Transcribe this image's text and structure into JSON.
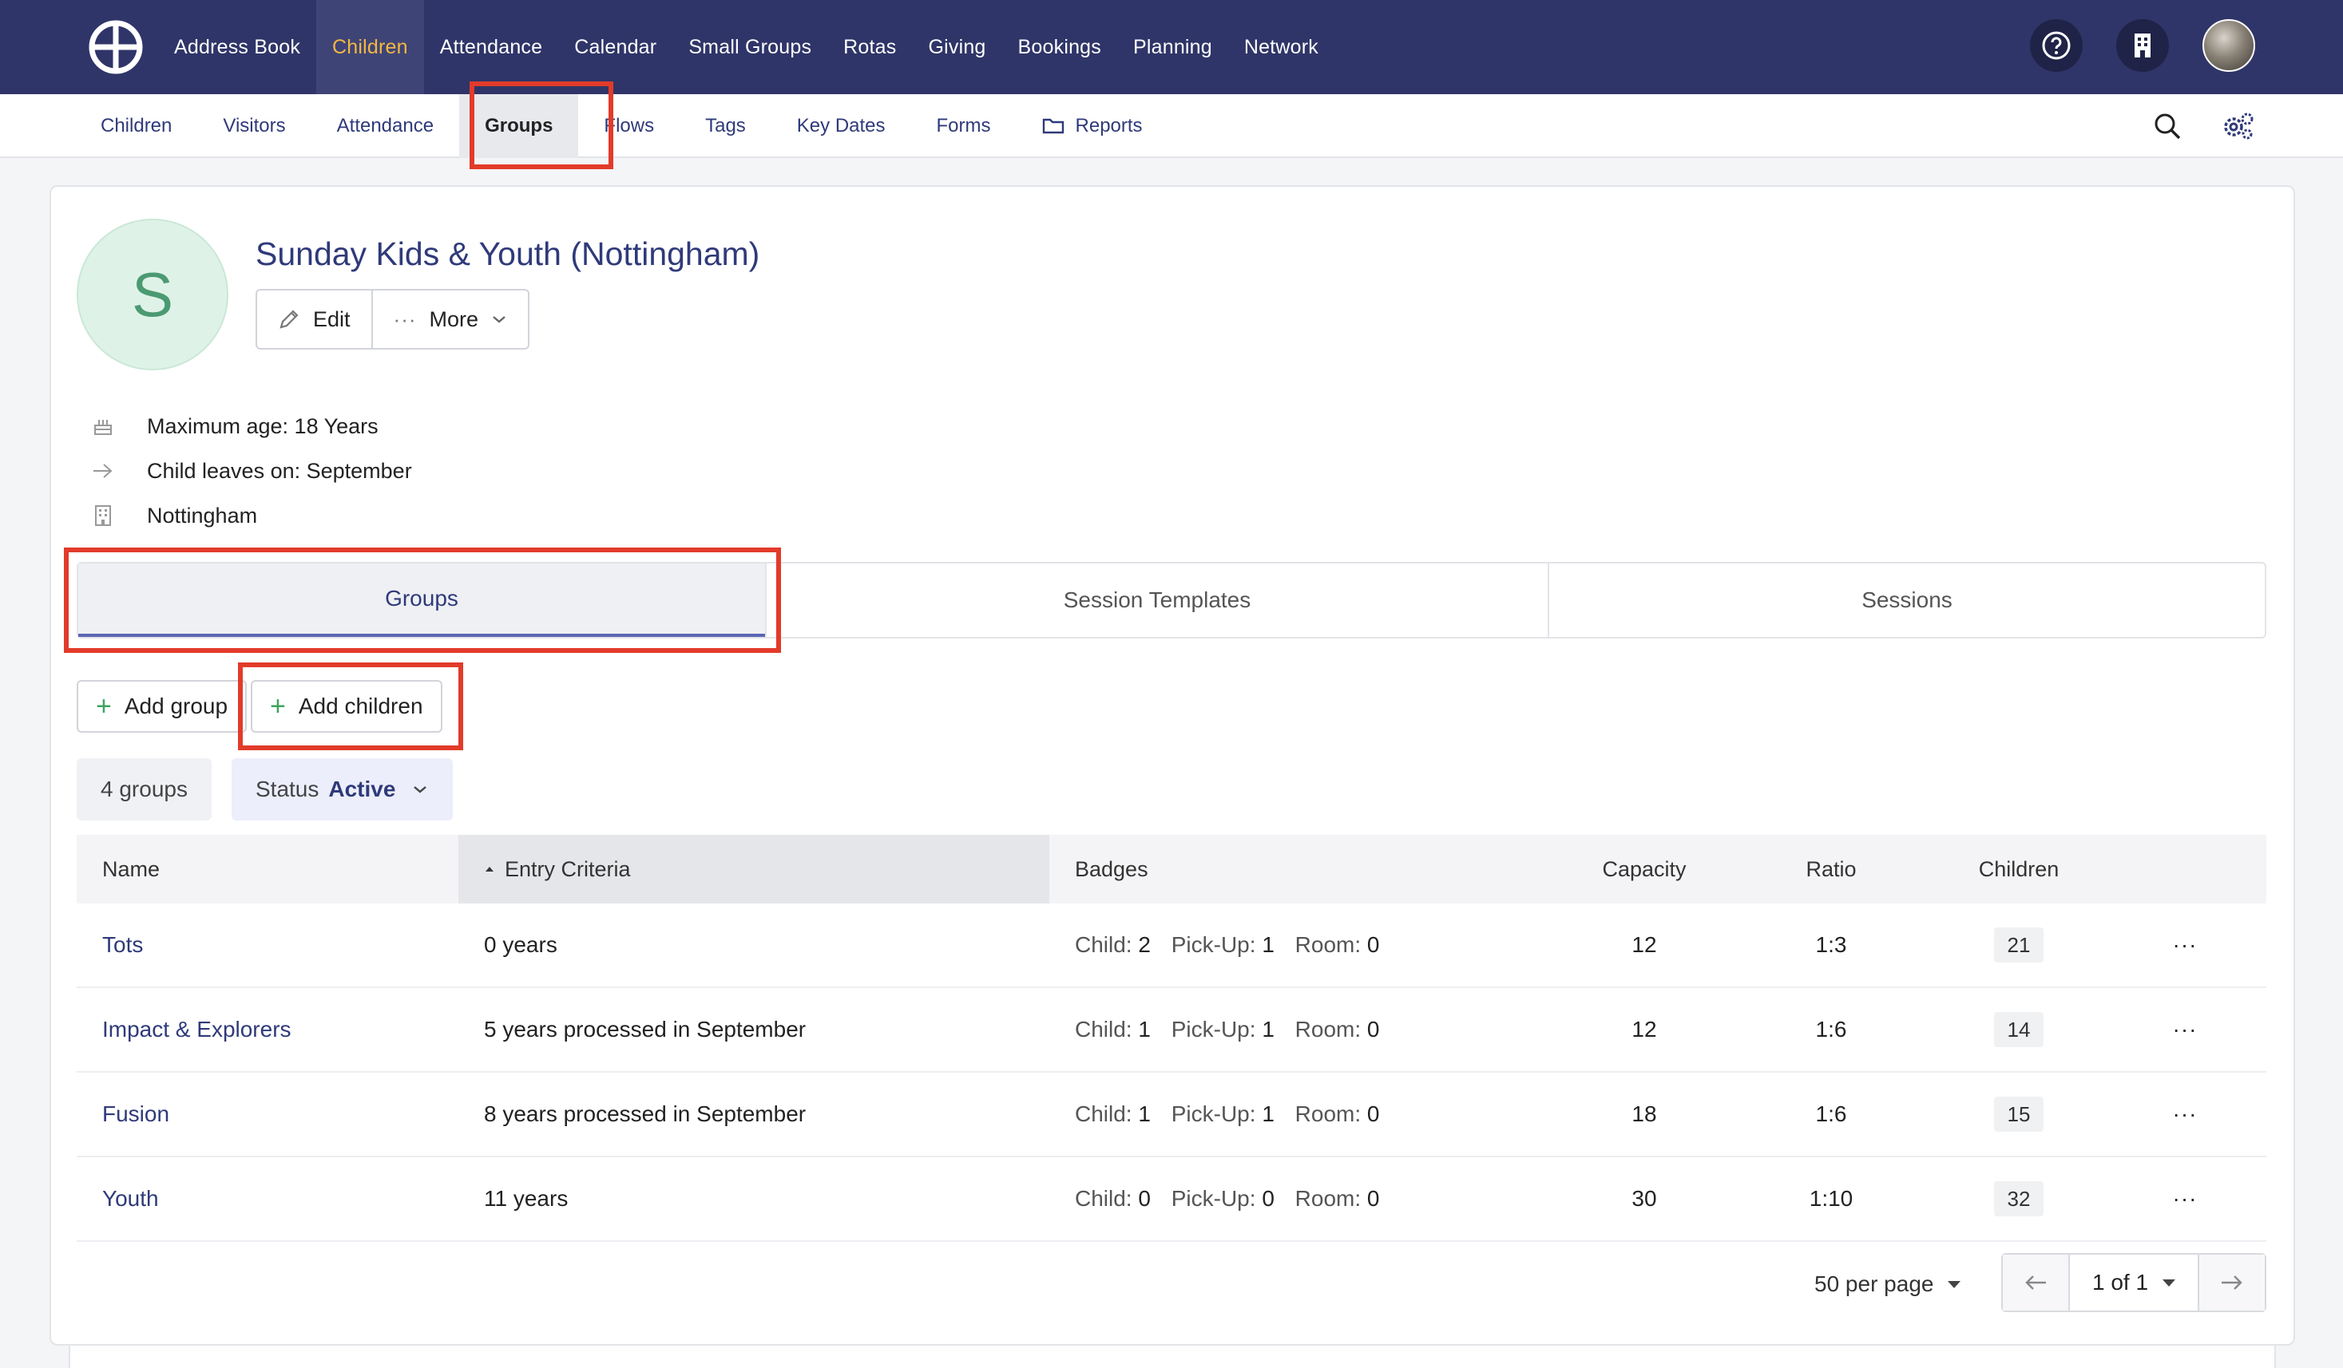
{
  "top_nav": {
    "items": [
      "Address Book",
      "Children",
      "Attendance",
      "Calendar",
      "Small Groups",
      "Rotas",
      "Giving",
      "Bookings",
      "Planning",
      "Network"
    ],
    "active": "Children"
  },
  "sub_nav": {
    "items": [
      "Children",
      "Visitors",
      "Attendance",
      "Groups",
      "Flows",
      "Tags",
      "Key Dates",
      "Forms",
      "Reports"
    ],
    "active": "Groups"
  },
  "group": {
    "initial": "S",
    "title": "Sunday Kids & Youth (Nottingham)",
    "edit_label": "Edit",
    "more_label": "More",
    "info": {
      "max_age": "Maximum age: 18 Years",
      "leaves_on": "Child leaves on: September",
      "location": "Nottingham"
    }
  },
  "tabs": [
    "Groups",
    "Session Templates",
    "Sessions"
  ],
  "actions": {
    "add_group": "Add group",
    "add_children": "Add children"
  },
  "filters": {
    "count": "4 groups",
    "status_label": "Status",
    "status_value": "Active"
  },
  "table": {
    "headers": {
      "name": "Name",
      "entry": "Entry Criteria",
      "badges": "Badges",
      "capacity": "Capacity",
      "ratio": "Ratio",
      "children": "Children"
    },
    "badge_labels": {
      "child": "Child:",
      "pickup": "Pick-Up:",
      "room": "Room:"
    },
    "rows": [
      {
        "name": "Tots",
        "entry": "0 years",
        "child": "2",
        "pickup": "1",
        "room": "0",
        "capacity": "12",
        "ratio": "1:3",
        "children": "21"
      },
      {
        "name": "Impact & Explorers",
        "entry": "5 years processed in September",
        "child": "1",
        "pickup": "1",
        "room": "0",
        "capacity": "12",
        "ratio": "1:6",
        "children": "14"
      },
      {
        "name": "Fusion",
        "entry": "8 years processed in September",
        "child": "1",
        "pickup": "1",
        "room": "0",
        "capacity": "18",
        "ratio": "1:6",
        "children": "15"
      },
      {
        "name": "Youth",
        "entry": "11 years",
        "child": "0",
        "pickup": "0",
        "room": "0",
        "capacity": "30",
        "ratio": "1:10",
        "children": "32"
      }
    ]
  },
  "pagination": {
    "per_page": "50 per page",
    "page": "1 of 1"
  },
  "colors": {
    "nav_bg": "#2f3568",
    "active_nav_text": "#f4b740",
    "link": "#2f3a7a",
    "highlight": "#e23b2a",
    "plus": "#3ea35f"
  }
}
